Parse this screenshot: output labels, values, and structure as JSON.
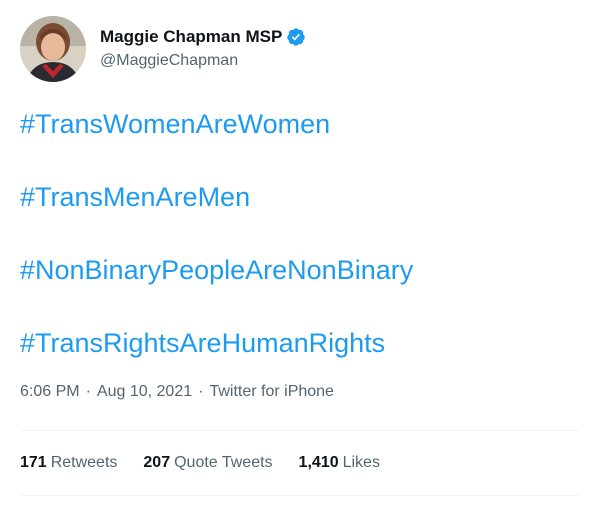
{
  "author": {
    "display_name": "Maggie Chapman MSP",
    "handle": "@MaggieChapman",
    "avatar_icon": "profile-photo",
    "verified_icon": "verified-badge-icon",
    "verified_color": "#1d9bf0"
  },
  "tweet": {
    "hashtags": [
      "#TransWomenAreWomen",
      "#TransMenAreMen",
      "#NonBinaryPeopleAreNonBinary",
      "#TransRightsAreHumanRights"
    ],
    "time": "6:06 PM",
    "date": "Aug 10, 2021",
    "source": "Twitter for iPhone",
    "separator": "·",
    "link_color": "#1d9bf0"
  },
  "stats": {
    "retweets_count": "171",
    "retweets_label": "Retweets",
    "quote_count": "207",
    "quote_label": "Quote Tweets",
    "likes_count": "1,410",
    "likes_label": "Likes"
  }
}
